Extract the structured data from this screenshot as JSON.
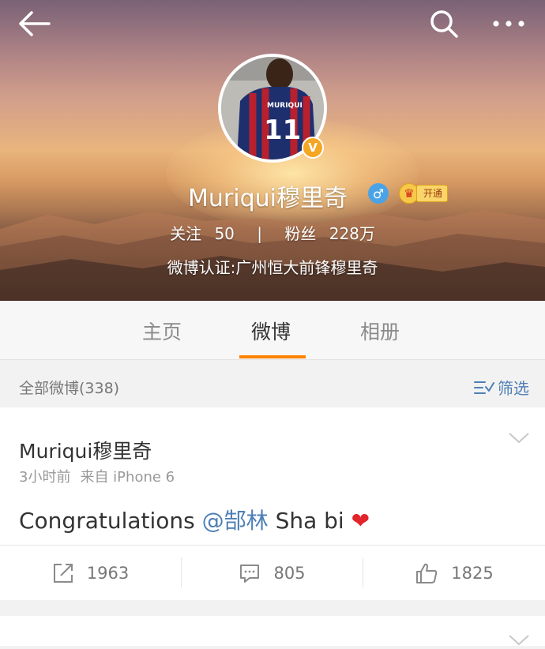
{
  "header": {
    "back_icon": "back-arrow-icon",
    "search_icon": "search-icon",
    "more_icon": "more-dots-icon"
  },
  "profile": {
    "name": "Muriqui穆里奇",
    "verified_badge": "V",
    "gender_symbol": "♂",
    "vip_open_label": "开通",
    "following_label": "关注",
    "following_count": "50",
    "stats_separator": "|",
    "followers_label": "粉丝",
    "followers_count": "228万",
    "certification": "微博认证:广州恒大前锋穆里奇",
    "avatar_jersey_name": "MURIQUI",
    "avatar_jersey_number": "11"
  },
  "tabs": [
    {
      "label": "主页",
      "active": false
    },
    {
      "label": "微博",
      "active": true
    },
    {
      "label": "相册",
      "active": false
    }
  ],
  "filter_bar": {
    "count_label": "全部微博(338)",
    "filter_label": "筛选"
  },
  "post": {
    "author": "Muriqui穆里奇",
    "time": "3小时前",
    "source": "来自 iPhone 6",
    "text_before": "Congratulations ",
    "mention": "@郜林",
    "text_after": " Sha bi ",
    "emoji": "❤️",
    "repost_count": "1963",
    "comment_count": "805",
    "like_count": "1825"
  },
  "colors": {
    "accent": "#ff8200",
    "link": "#4e7fb5",
    "verified": "#f5a623",
    "gender": "#4aa3e6"
  }
}
